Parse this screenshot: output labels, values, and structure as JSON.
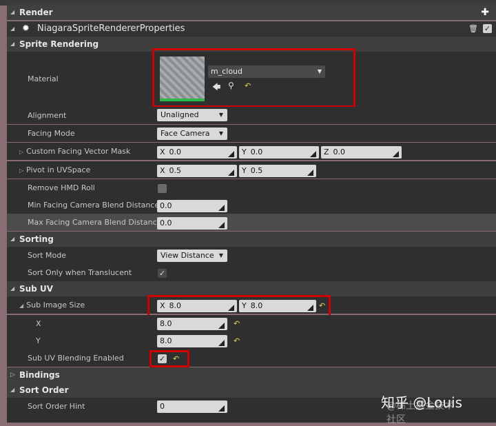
{
  "render": {
    "title": "Render",
    "add_icon": "plus-icon"
  },
  "properties_header": {
    "title": "NiagaraSpriteRendererProperties",
    "sun_icon": "gear-sun-icon",
    "trash_icon": "trash-icon",
    "checkbox_checked": true
  },
  "sprite_rendering": {
    "title": "Sprite Rendering",
    "material": {
      "label": "Material",
      "value": "m_cloud",
      "icons": [
        "use-selected-icon",
        "browse-icon",
        "reset-icon"
      ]
    },
    "alignment": {
      "label": "Alignment",
      "value": "Unaligned"
    },
    "facing_mode": {
      "label": "Facing Mode",
      "value": "Face Camera"
    },
    "custom_facing_vector_mask": {
      "label": "Custom Facing Vector Mask",
      "x": "0.0",
      "y": "0.0",
      "z": "0.0"
    },
    "pivot_in_uvspace": {
      "label": "Pivot in UVSpace",
      "x": "0.5",
      "y": "0.5"
    },
    "remove_hmd_roll": {
      "label": "Remove HMD Roll",
      "checked": false
    },
    "min_facing_camera_blend_distance": {
      "label": "Min Facing Camera Blend Distance",
      "value": "0.0"
    },
    "max_facing_camera_blend_distance": {
      "label": "Max Facing Camera Blend Distance",
      "value": "0.0"
    }
  },
  "sorting": {
    "title": "Sorting",
    "sort_mode": {
      "label": "Sort Mode",
      "value": "View Distance"
    },
    "sort_only_when_translucent": {
      "label": "Sort Only when Translucent",
      "checked": true
    }
  },
  "sub_uv": {
    "title": "Sub UV",
    "sub_image_size": {
      "label": "Sub Image Size",
      "x": "8.0",
      "y": "8.0"
    },
    "x": {
      "label": "X",
      "value": "8.0"
    },
    "y": {
      "label": "Y",
      "value": "8.0"
    },
    "blending_enabled": {
      "label": "Sub UV Blending Enabled",
      "checked": true
    }
  },
  "bindings": {
    "title": "Bindings"
  },
  "sort_order": {
    "title": "Sort Order",
    "hint": {
      "label": "Sort Order Hint",
      "value": "0"
    }
  },
  "axis_labels": {
    "x": "X",
    "y": "Y",
    "z": "Z"
  },
  "watermark": {
    "main": "知乎 @Louis",
    "sub": "@稀土掘金技术社区"
  }
}
